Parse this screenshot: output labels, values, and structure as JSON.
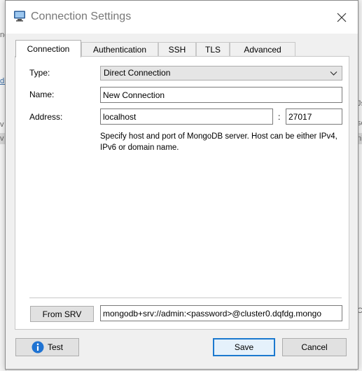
{
  "window": {
    "title": "Connection Settings"
  },
  "background": {
    "fragments": [
      "ngo",
      "dit",
      "v",
      "v",
      "Js",
      "sc",
      "ni",
      "C"
    ]
  },
  "tabs": [
    {
      "label": "Connection",
      "active": true
    },
    {
      "label": "Authentication",
      "active": false
    },
    {
      "label": "SSH",
      "active": false
    },
    {
      "label": "TLS",
      "active": false
    },
    {
      "label": "Advanced",
      "active": false
    }
  ],
  "form": {
    "type_label": "Type:",
    "type_value": "Direct Connection",
    "name_label": "Name:",
    "name_value": "New Connection",
    "address_label": "Address:",
    "host_value": "localhost",
    "port_separator": ":",
    "port_value": "27017",
    "help_text": "Specify host and port of MongoDB server. Host can be either IPv4, IPv6 or domain name."
  },
  "srv": {
    "button_label": "From SRV",
    "value": "mongodb+srv://admin:<password>@cluster0.dqfdg.mongo"
  },
  "footer": {
    "test_label": "Test",
    "save_label": "Save",
    "cancel_label": "Cancel"
  },
  "colors": {
    "accent": "#1c79cf",
    "info_icon": "#1f73d2"
  }
}
